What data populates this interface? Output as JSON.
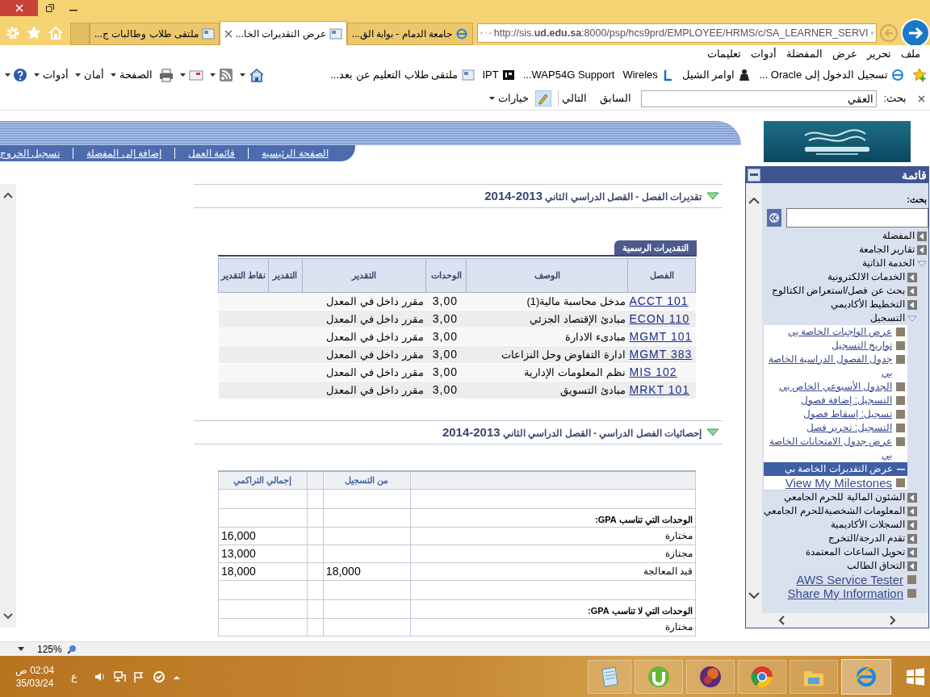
{
  "tabs": [
    {
      "label": "جامعة الدمام - بوابة الق...",
      "selected": false
    },
    {
      "label": "عرض التقديرات الخا...",
      "selected": true
    },
    {
      "label": "ملتقى طلاب وطالبات ج...",
      "selected": false
    }
  ],
  "address_bar": {
    "url": "http://sis.**ud.edu.sa**:8000/psp/hcs9prd/EMPLOYEE/HRMS/c/SA_LEARNER_SERVI"
  },
  "menu_bar": [
    "ملف",
    "تحرير",
    "عرض",
    "المفضلة",
    "أدوات",
    "تعليمات"
  ],
  "favorites_bar": [
    "تسجيل الدخول إلى Oracle ...",
    "اوامر الشيل",
    "Wireles",
    "WAP54G Support...",
    "IPT",
    "ملتقى طلاب التعليم عن بعد..."
  ],
  "command_bar": [
    "الصفحة",
    "أمان",
    "أدوات"
  ],
  "find_bar": {
    "label": "بحث:",
    "value": "العقي",
    "previous": "السابق",
    "next": "التالي",
    "options": "خيارات"
  },
  "portal_nav": [
    "الصفحة الرئيسية",
    "قائمة العمل",
    "إضافة إلى المفضلة",
    "تسجيل الخروج"
  ],
  "grades": {
    "title": "تقديرات الفصل - القصل الدراسي الثاني",
    "year": "2013-2014",
    "tab": "التقديرات الرسمية",
    "columns": [
      "الفصل",
      "الوصف",
      "الوحدات",
      "التقدير",
      "التقدير",
      "نقاط التقدير"
    ],
    "rows": [
      {
        "course": "ACCT 101",
        "description": "مدخل محاسبة مالية(1)",
        "units": "3,00",
        "grading": "مقرر داخل في المعدل"
      },
      {
        "course": "ECON 110",
        "description": "مبادئ الإقتصاد الجزئي",
        "units": "3,00",
        "grading": "مقرر داخل في المعدل"
      },
      {
        "course": "MGMT 101",
        "description": "مبادىء الادارة",
        "units": "3,00",
        "grading": "مقرر داخل في المعدل"
      },
      {
        "course": "MGMT 383",
        "description": "ادارة التفاوض وحل النزاعات",
        "units": "3,00",
        "grading": "مقرر داخل في المعدل"
      },
      {
        "course": "MIS 102",
        "description": "نظم المعلومات الإدارية",
        "units": "3,00",
        "grading": "مقرر داخل في المعدل"
      },
      {
        "course": "MRKT 101",
        "description": "مبادئ التسويق",
        "units": "3,00",
        "grading": "مقرر داخل في المعدل"
      }
    ]
  },
  "statistics": {
    "title": "إحصائيات الفصل الدراسي - القصل الدراسي الثاني",
    "year": "2013-2014",
    "columns": {
      "term": "من التسجيل",
      "cumulative": "إجمالي التراكمي"
    },
    "rows": [
      {
        "kind": "blank"
      },
      {
        "kind": "heading",
        "label": "الوحدات التي تناسب **GPA**:"
      },
      {
        "kind": "value",
        "label": "مختارة",
        "cumulative": "16,000"
      },
      {
        "kind": "value",
        "label": "مجتازة",
        "cumulative": "13,000"
      },
      {
        "kind": "value",
        "label": "قيد المعالجة",
        "term": "18,000",
        "cumulative": "18,000"
      },
      {
        "kind": "blank"
      },
      {
        "kind": "heading",
        "label": "الوحدات التي لا تناسب **GPA**:"
      },
      {
        "kind": "value",
        "label": "مختارة"
      }
    ]
  },
  "menu": {
    "title": "قائمة",
    "search_label": "بحث:",
    "items": [
      {
        "kind": "folder",
        "label": "المفضلة",
        "expanded": false
      },
      {
        "kind": "folder",
        "label": "تقارير الجامعة",
        "expanded": false
      },
      {
        "kind": "folder",
        "label": "الخدمة الذاتية",
        "expanded": true,
        "children": [
          {
            "kind": "folder",
            "label": "الخدمات الالكترونية",
            "expanded": false
          },
          {
            "kind": "folder",
            "label": "بحث عن فصل/استعراض الكتالوج",
            "expanded": false
          },
          {
            "kind": "folder",
            "label": "التخطيط الأكاديمي",
            "expanded": false
          },
          {
            "kind": "folder",
            "label": "التسجيل",
            "expanded": true,
            "children": [
              {
                "kind": "link",
                "label": "عرض الواجبات الخاصة بي",
                "selected": false
              },
              {
                "kind": "link",
                "label": "تواريخ التسجيل",
                "selected": false
              },
              {
                "kind": "link",
                "label": "جدول الفصول الدراسية الخاصة بي",
                "selected": false
              },
              {
                "kind": "link",
                "label": "الجدول الأسبوعي الخاص بي",
                "selected": false
              },
              {
                "kind": "link",
                "label": "التسجيل: إضافة فصول",
                "selected": false
              },
              {
                "kind": "link",
                "label": "تسجيل: إسقاط فصول",
                "selected": false
              },
              {
                "kind": "link",
                "label": "التسجيل: تحرير فصل",
                "selected": false
              },
              {
                "kind": "link",
                "label": "عرض جدول الامتحانات الخاصة بي",
                "selected": false
              },
              {
                "kind": "link",
                "label": "عرض التقديرات الخاصة بي",
                "selected": true
              },
              {
                "kind": "link",
                "label": "View My Milestones",
                "selected": false
              }
            ]
          },
          {
            "kind": "folder",
            "label": "الشئون المالية للحرم الجامعي",
            "expanded": false
          },
          {
            "kind": "folder",
            "label": "المعلومات الشخصيةللحرم الجامعي",
            "expanded": false
          },
          {
            "kind": "folder",
            "label": "السجلات الأكاديمية",
            "expanded": false
          },
          {
            "kind": "folder",
            "label": "تقدم الدرجة/التخرج",
            "expanded": false
          },
          {
            "kind": "folder",
            "label": "تحويل الساعات المعتمدة",
            "expanded": false
          },
          {
            "kind": "folder",
            "label": "التحاق الطالب",
            "expanded": false
          },
          {
            "kind": "link",
            "label": "AWS Service Tester",
            "selected": false
          },
          {
            "kind": "link",
            "label": "Share My Information",
            "selected": false
          }
        ]
      }
    ]
  },
  "status_bar": {
    "zoom": "125%"
  },
  "taskbar": {
    "time": "02:04 ص",
    "date": "35/03/24",
    "language": "ع"
  }
}
